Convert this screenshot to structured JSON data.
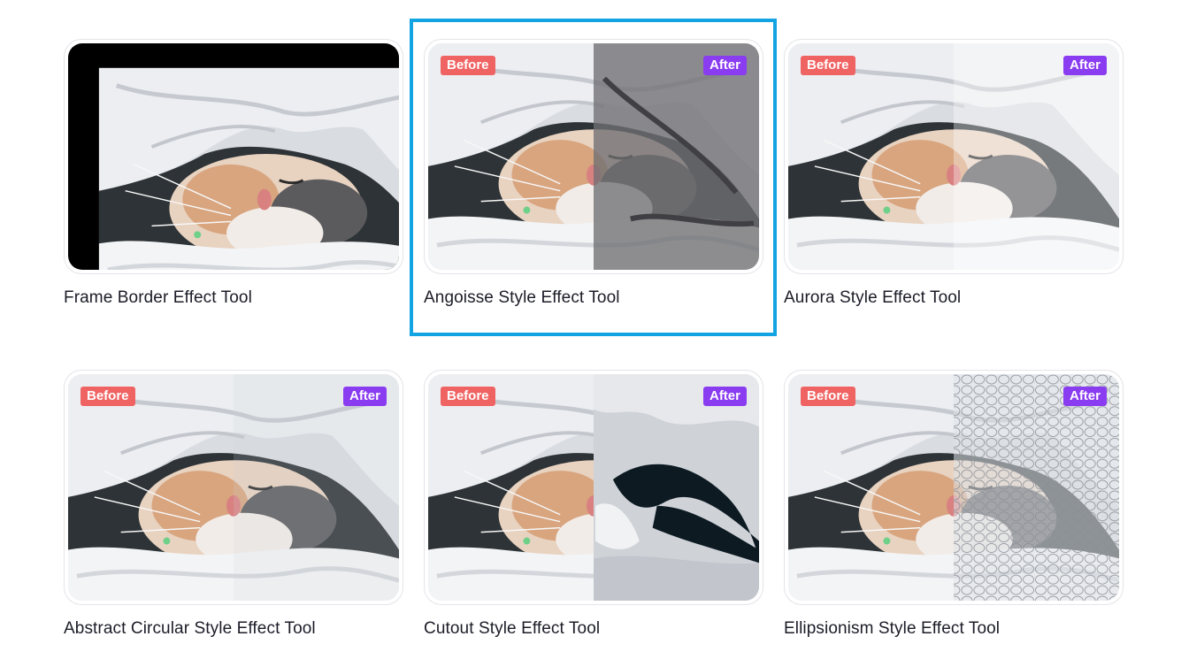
{
  "tools": [
    {
      "title": "Frame Border Effect Tool",
      "before": "",
      "after": ""
    },
    {
      "title": "Angoisse Style Effect Tool",
      "before": "Before",
      "after": "After"
    },
    {
      "title": "Aurora Style Effect Tool",
      "before": "Before",
      "after": "After"
    },
    {
      "title": "Abstract Circular Style Effect Tool",
      "before": "Before",
      "after": "After"
    },
    {
      "title": "Cutout Style Effect Tool",
      "before": "Before",
      "after": "After"
    },
    {
      "title": "Ellipsionism Style Effect Tool",
      "before": "Before",
      "after": "After"
    }
  ],
  "selected_index": 1,
  "colors": {
    "before_badge": "#f06363",
    "after_badge": "#8a3cf0",
    "selection_outline": "#12a3e3",
    "title_text": "#1c1c28"
  }
}
